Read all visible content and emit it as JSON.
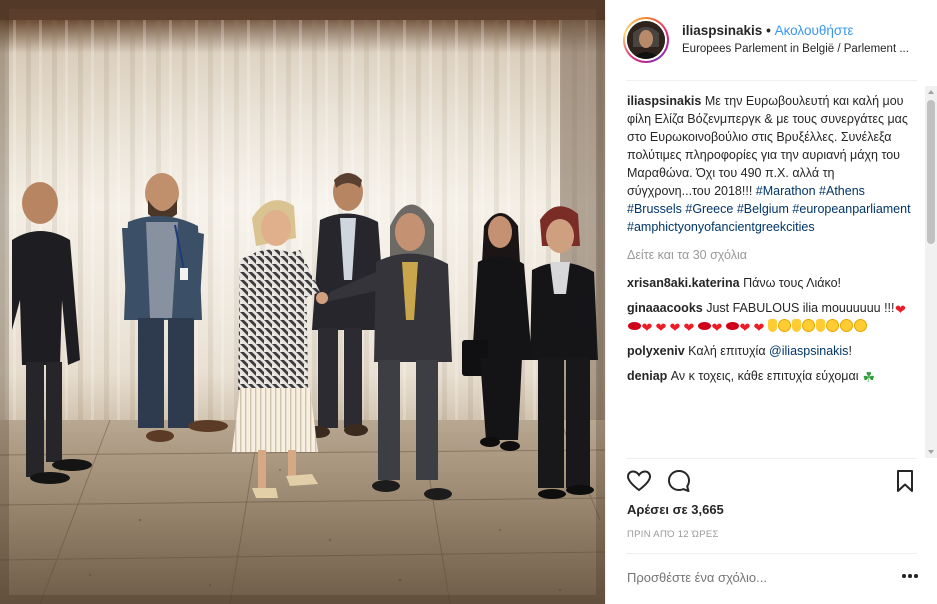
{
  "post": {
    "username": "iliaspsinakis",
    "dot": "•",
    "follow_label": "Ακολουθήστε",
    "location": "Europees Parlement in België / Parlement ..."
  },
  "caption": {
    "username": "iliaspsinakis",
    "text": "Με την Ευρωβουλευτή και καλή μου φίλη Ελίζα Βόζενμπεργκ & με τους συνεργάτες μας στο Ευρωκοινοβούλιο στις Βρυξέλλες. Συνέλεξα πολύτιμες πληροφορίες για την αυριανή μάχη του Μαραθώνα. Όχι του 490 π.Χ. αλλά τη σύγχρονη...του 2018!!!",
    "hashtags": [
      "#Marathon",
      "#Athens",
      "#Brussels",
      "#Greece",
      "#Belgium",
      "#europeanparliament",
      "#amphictyonyofancientgreekcities"
    ]
  },
  "view_more_comments": "Δείτε και τα 30 σχόλια",
  "comments": [
    {
      "username": "xrisan8aki.katerina",
      "text": "Πάνω τους Λιάκο!"
    },
    {
      "username": "ginaaacooks",
      "text": "Just FABULOUS ilia mouuuuuu !!!"
    },
    {
      "username": "polyxeniv",
      "text": "Καλή επιτυχία",
      "mention": "@iliaspsinakis",
      "suffix": "!"
    },
    {
      "username": "deniap",
      "text": "Αν κ τοχεις, κάθε επιτυχία εύχομαι"
    }
  ],
  "icons": {
    "like": "heart-outline-icon",
    "comment": "comment-bubble-icon",
    "save": "bookmark-icon",
    "options": "more-options-icon"
  },
  "likes_label": "Αρέσει σε 3,665",
  "time_label": "ΠΡΙΝ ΑΠΌ 12 ΏΡΕΣ",
  "comment_placeholder": "Προσθέστε ένα σχόλιο...",
  "colors": {
    "link": "#3897f0",
    "hashtag": "#003569",
    "muted": "#999999",
    "text": "#262626"
  }
}
